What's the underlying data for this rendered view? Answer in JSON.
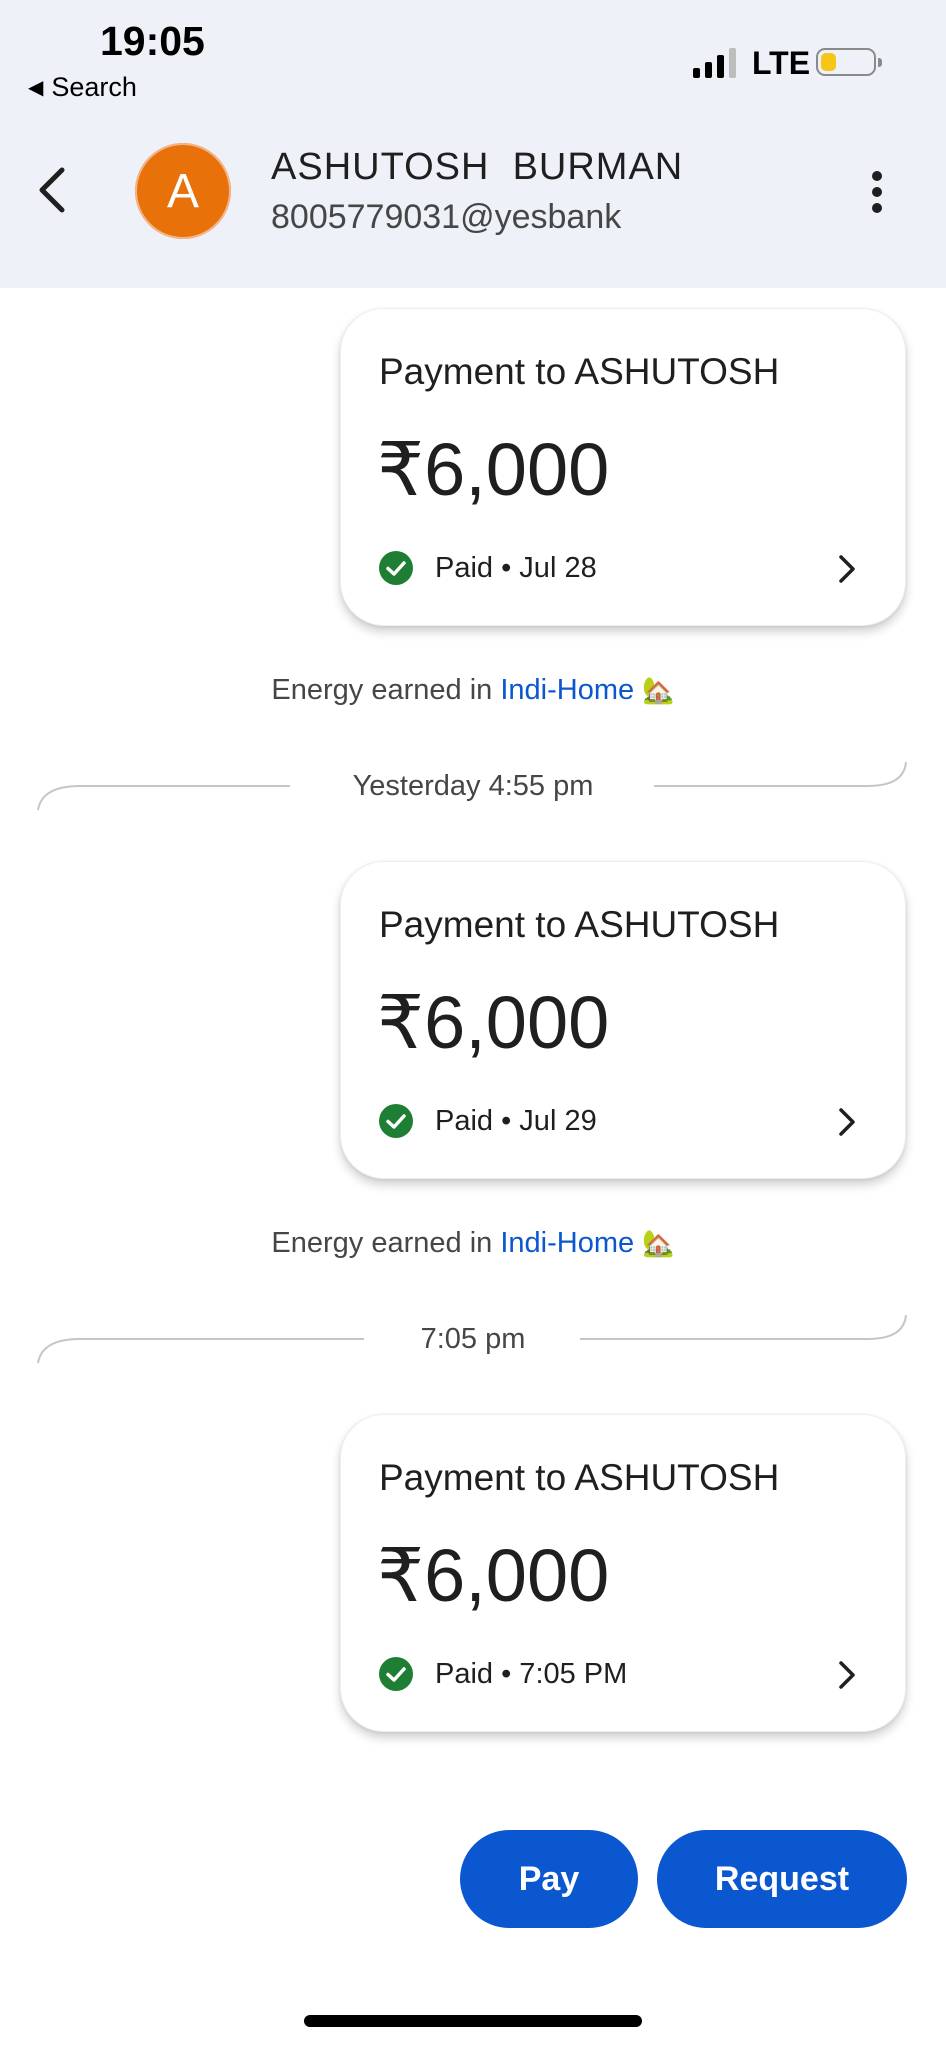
{
  "status_bar": {
    "time": "19:05",
    "back_label": "Search",
    "network": "LTE",
    "battery_level": 0.3
  },
  "header": {
    "avatar_initial": "A",
    "contact_name": "ASHUTOSH  BURMAN",
    "contact_upi": "8005779031@yesbank"
  },
  "cards": [
    {
      "title": "Payment to ASHUTOSH",
      "amount": "₹6,000",
      "status": "Paid • Jul 28"
    },
    {
      "title": "Payment to ASHUTOSH",
      "amount": "₹6,000",
      "status": "Paid • Jul 29"
    },
    {
      "title": "Payment to ASHUTOSH",
      "amount": "₹6,000",
      "status": "Paid • 7:05 PM"
    }
  ],
  "energy": [
    {
      "prefix": "Energy earned in ",
      "link": "Indi-Home",
      "emoji": "🏡"
    },
    {
      "prefix": "Energy earned in ",
      "link": "Indi-Home",
      "emoji": "🏡"
    }
  ],
  "dividers": [
    {
      "label": "Yesterday 4:55 pm"
    },
    {
      "label": "7:05 pm"
    }
  ],
  "actions": {
    "pay_label": "Pay",
    "request_label": "Request"
  },
  "colors": {
    "accent": "#0b57d0",
    "avatar": "#e8710a",
    "paid_check": "#1e7e34",
    "header_bg": "#eef2f8"
  }
}
